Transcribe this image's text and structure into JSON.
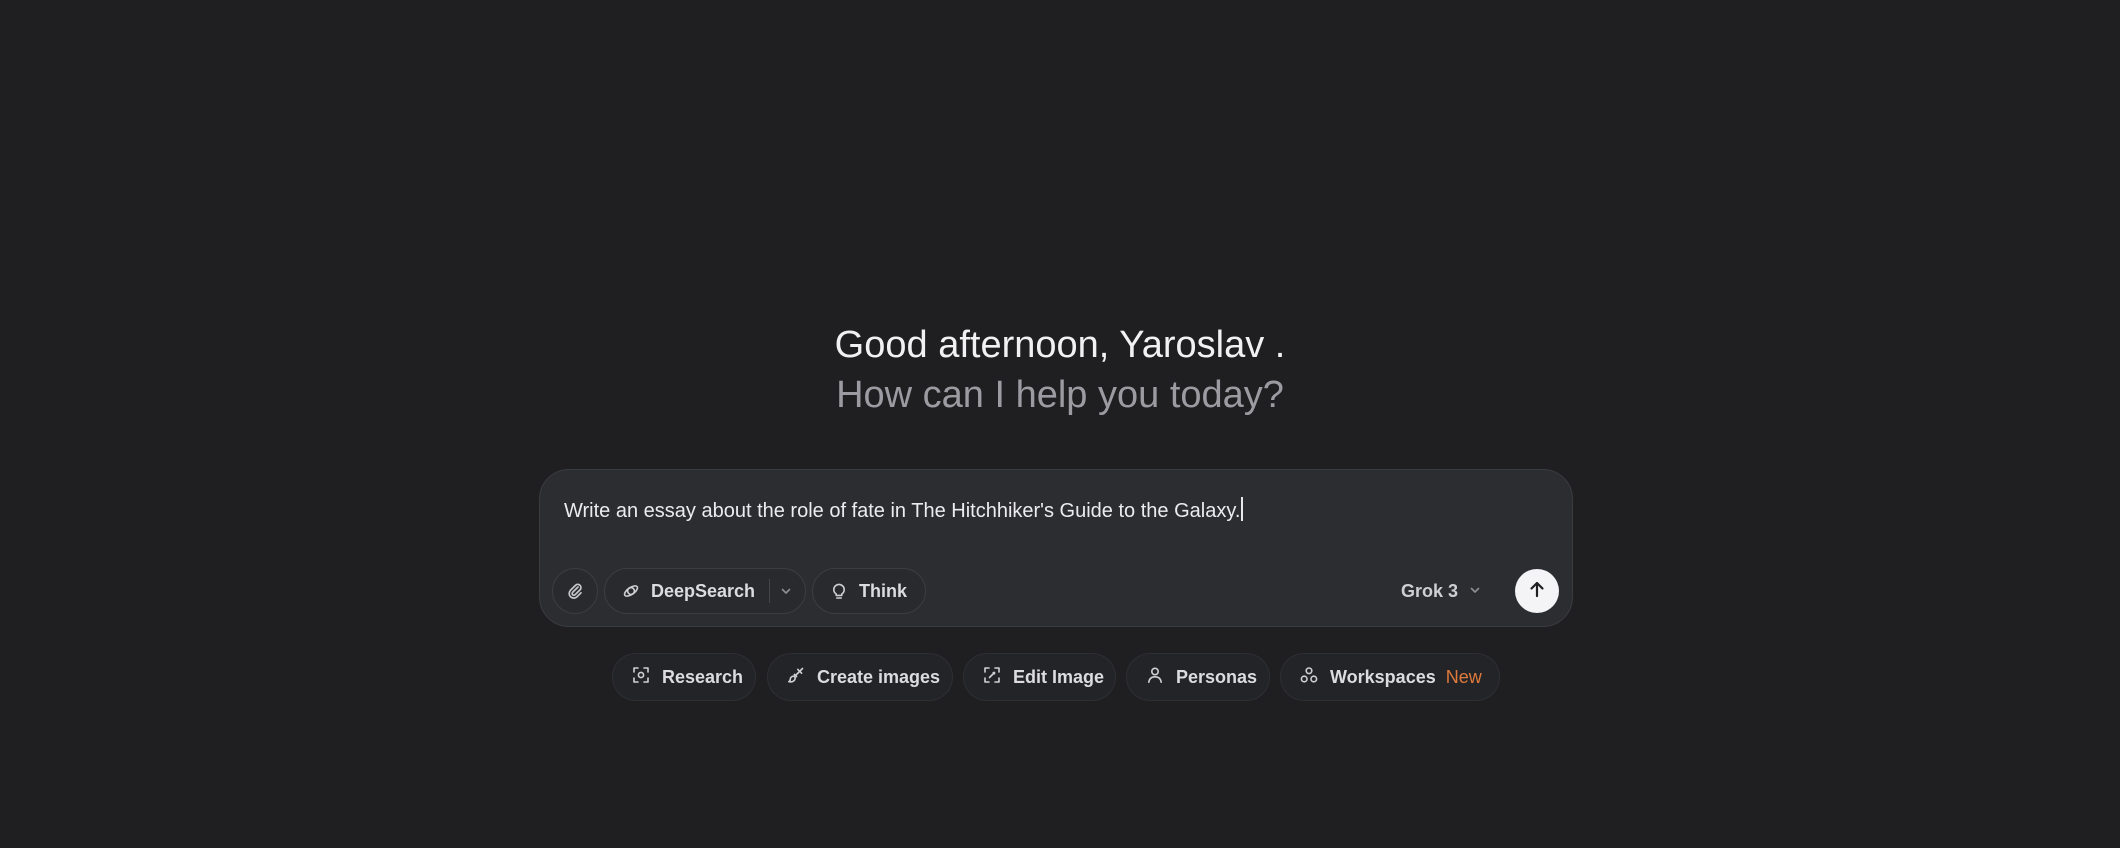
{
  "greeting": {
    "line1": "Good afternoon, Yaroslav .",
    "line2": "How can I help you today?"
  },
  "composer": {
    "prompt_text": "Write an essay about the role of fate in The Hitchhiker's Guide to the Galaxy.",
    "attach_icon": "paperclip-icon",
    "deepsearch_label": "DeepSearch",
    "deepsearch_icon": "deepsearch-icon",
    "think_label": "Think",
    "think_icon": "lightbulb-icon",
    "model_label": "Grok 3",
    "send_icon": "arrow-up-icon"
  },
  "actions": [
    {
      "label": "Research",
      "icon": "research-icon"
    },
    {
      "label": "Create images",
      "icon": "brush-icon"
    },
    {
      "label": "Edit Image",
      "icon": "edit-image-icon"
    },
    {
      "label": "Personas",
      "icon": "person-icon"
    },
    {
      "label": "Workspaces",
      "icon": "workspaces-icon",
      "badge": "New"
    }
  ],
  "colors": {
    "background": "#1f1f22",
    "composer": "#2c2d30",
    "badge": "#e07a3c",
    "send_button": "#f4f4f6"
  }
}
